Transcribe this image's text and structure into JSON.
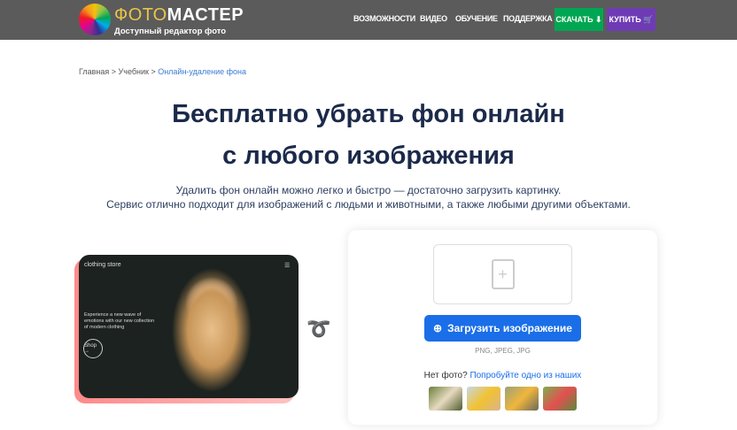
{
  "header": {
    "brand_a": "ФОТО",
    "brand_b": "МАСТЕР",
    "tagline": "Доступный редактор фото",
    "nav": [
      "ВОЗМОЖНОСТИ",
      "ВИДЕО",
      "ОБУЧЕНИЕ",
      "ПОДДЕРЖКА"
    ],
    "download": "СКАЧАТЬ ⬇",
    "buy": "КУПИТЬ 🛒"
  },
  "breadcrumb": {
    "home": "Главная",
    "sep": " > ",
    "tutorial": "Учебник",
    "current": "Онлайн-удаление фона"
  },
  "title": {
    "line1": "Бесплатно убрать фон онлайн",
    "line2": "с любого изображения"
  },
  "subtitle": {
    "line1": "Удалить фон онлайн можно легко и быстро — достаточно загрузить картинку.",
    "line2": "Сервис отлично подходит для изображений с людьми и животными, а также любыми другими объектами."
  },
  "preview": {
    "store": "clothing store",
    "text": "Experience a new wave of emotions with our new collection of modern clothing",
    "shop": "Shop →"
  },
  "upload": {
    "button": "Загрузить изображение",
    "formats": "PNG, JPEG, JPG",
    "no_photo": "Нет фото?",
    "try": "Попробуйте одно из наших"
  },
  "colors": {
    "accent": "#1a6ee8",
    "download": "#00a651",
    "buy": "#6f3bb5"
  }
}
